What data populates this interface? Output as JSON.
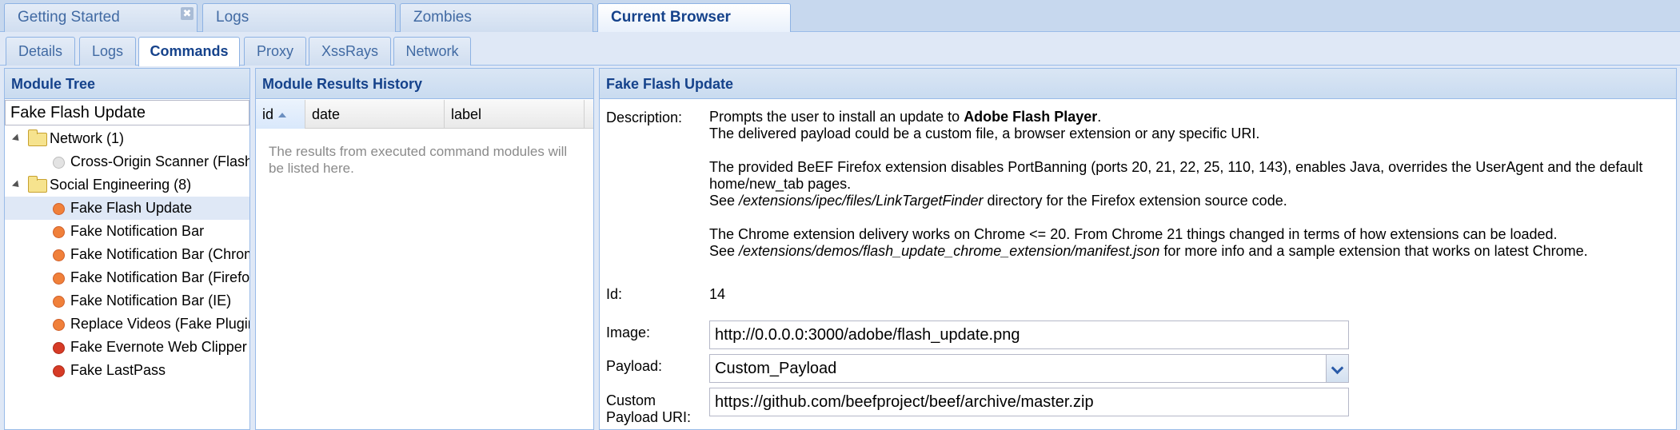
{
  "top_tabs": [
    {
      "label": "Getting Started"
    },
    {
      "label": "Logs"
    },
    {
      "label": "Zombies"
    },
    {
      "label": "Current Browser"
    }
  ],
  "close_glyph": "✖",
  "sub_tabs": [
    {
      "label": "Details"
    },
    {
      "label": "Logs"
    },
    {
      "label": "Commands"
    },
    {
      "label": "Proxy"
    },
    {
      "label": "XssRays"
    },
    {
      "label": "Network"
    }
  ],
  "module_tree": {
    "title": "Module Tree",
    "search_value": "Fake Flash Update",
    "items": [
      {
        "label": "Network (1)",
        "kind": "folder",
        "color": ""
      },
      {
        "label": "Cross-Origin Scanner (Flash)",
        "kind": "leaf",
        "color": "#d9d9d9"
      },
      {
        "label": "Social Engineering (8)",
        "kind": "folder",
        "color": ""
      },
      {
        "label": "Fake Flash Update",
        "kind": "leaf",
        "color": "#f0803a"
      },
      {
        "label": "Fake Notification Bar",
        "kind": "leaf",
        "color": "#f0803a"
      },
      {
        "label": "Fake Notification Bar (Chrome)",
        "kind": "leaf",
        "color": "#f0803a"
      },
      {
        "label": "Fake Notification Bar (Firefox)",
        "kind": "leaf",
        "color": "#f0803a"
      },
      {
        "label": "Fake Notification Bar (IE)",
        "kind": "leaf",
        "color": "#f0803a"
      },
      {
        "label": "Replace Videos (Fake Plugin)",
        "kind": "leaf",
        "color": "#f0803a"
      },
      {
        "label": "Fake Evernote Web Clipper",
        "kind": "leaf",
        "color": "#d63b26"
      },
      {
        "label": "Fake LastPass",
        "kind": "leaf",
        "color": "#d63b26"
      }
    ]
  },
  "results": {
    "title": "Module Results History",
    "columns": [
      "id",
      "date",
      "label"
    ],
    "empty_message": "The results from executed command modules will be listed here."
  },
  "details": {
    "title": "Fake Flash Update",
    "description_label": "Description:",
    "desc_line1_prefix": "Prompts the user to install an update to ",
    "desc_line1_bold": "Adobe Flash Player",
    "desc_line1_suffix": ".",
    "desc_line2": "The delivered payload could be a custom file, a browser extension or any specific URI.",
    "desc_para2": "The provided BeEF Firefox extension disables PortBanning (ports 20, 21, 22, 25, 110, 143), enables Java, overrides the UserAgent and the default home/new_tab pages.",
    "desc_see1_prefix": "See ",
    "desc_see1_path": "/extensions/ipec/files/LinkTargetFinder",
    "desc_see1_suffix": " directory for the Firefox extension source code.",
    "desc_para3": "The Chrome extension delivery works on Chrome <= 20. From Chrome 21 things changed in terms of how extensions can be loaded.",
    "desc_see2_prefix": "See ",
    "desc_see2_path": "/extensions/demos/flash_update_chrome_extension/manifest.json",
    "desc_see2_suffix": " for more info and a sample extension that works on latest Chrome.",
    "id_label": "Id:",
    "id_value": "14",
    "image_label": "Image:",
    "image_value": "http://0.0.0.0:3000/adobe/flash_update.png",
    "payload_label": "Payload:",
    "payload_value": "Custom_Payload",
    "custom_uri_label_1": "Custom",
    "custom_uri_label_2": "Payload URI:",
    "custom_uri_value": "https://github.com/beefproject/beef/archive/master.zip"
  }
}
